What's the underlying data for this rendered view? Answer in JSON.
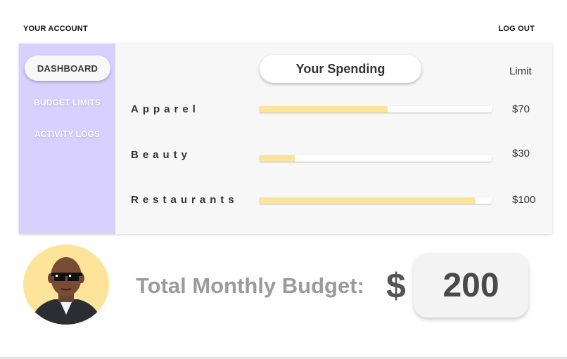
{
  "topbar": {
    "account_label": "YOUR ACCOUNT",
    "logout_label": "LOG OUT"
  },
  "sidebar": {
    "items": [
      {
        "label": "DASHBOARD",
        "active": true
      },
      {
        "label": "BUDGET LIMITS",
        "active": false
      },
      {
        "label": "ACTIVITY LOGS",
        "active": false
      }
    ]
  },
  "spending": {
    "title": "Your Spending",
    "limit_header": "Limit",
    "rows": [
      {
        "category": "Apparel",
        "limit": "$70",
        "progress": 0.55
      },
      {
        "category": "Beauty",
        "limit": "$30",
        "progress": 0.15
      },
      {
        "category": "Restaurants",
        "limit": "$100",
        "progress": 0.93
      }
    ]
  },
  "budget": {
    "label": "Total Monthly Budget:",
    "currency": "$",
    "value": "200"
  },
  "colors": {
    "sidebar": "#d8d0ff",
    "bar_fill": "#fde49a",
    "avatar_bg": "#fde49a"
  }
}
